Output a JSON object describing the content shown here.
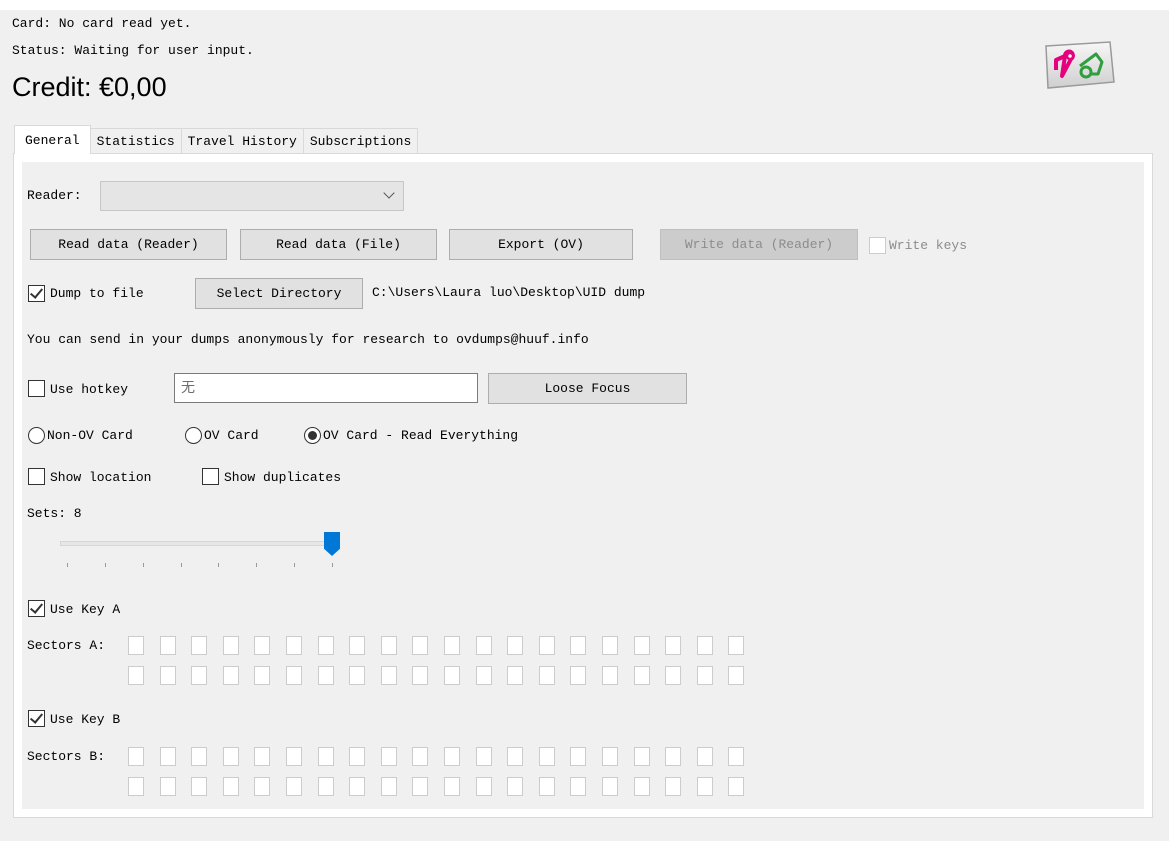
{
  "header": {
    "card_label": "Card: No card read yet.",
    "status_label": "Status: Waiting for user input.",
    "credit_label": "Credit: €0,00",
    "logo_icon": "ov-chipkaart-logo",
    "logo_colors": {
      "pink": "#e6007e",
      "green": "#2e9e3e"
    }
  },
  "tabs": [
    {
      "label": "General",
      "active": true
    },
    {
      "label": "Statistics",
      "active": false
    },
    {
      "label": "Travel History",
      "active": false
    },
    {
      "label": "Subscriptions",
      "active": false
    }
  ],
  "general": {
    "reader_label": "Reader:",
    "reader_value": "",
    "buttons": {
      "read_reader": "Read data (Reader)",
      "read_file": "Read data (File)",
      "export_ov": "Export (OV)",
      "write_reader": "Write data (Reader)",
      "select_directory": "Select Directory",
      "loose_focus": "Loose Focus"
    },
    "write_keys": {
      "label": "Write keys",
      "checked": false,
      "enabled": false
    },
    "dump_to_file": {
      "label": "Dump to file",
      "checked": true
    },
    "dump_path": "C:\\Users\\Laura luo\\Desktop\\UID dump",
    "research_note": "You can send in your dumps anonymously for research to ovdumps@huuf.info",
    "use_hotkey": {
      "label": "Use hotkey",
      "checked": false
    },
    "hotkey_value": "无",
    "card_mode": {
      "options": [
        "Non-OV Card",
        "OV Card",
        "OV Card - Read Everything"
      ],
      "selected": "OV Card - Read Everything"
    },
    "show_location": {
      "label": "Show location",
      "checked": false
    },
    "show_duplicates": {
      "label": "Show duplicates",
      "checked": false
    },
    "sets_label": "Sets: 8",
    "sets_slider": {
      "min": 1,
      "max": 8,
      "value": 8,
      "accent": "#0078d7"
    },
    "use_key_a": {
      "label": "Use Key A",
      "checked": true
    },
    "sectors_a_label": "Sectors A:",
    "use_key_b": {
      "label": "Use Key B",
      "checked": true
    },
    "sectors_b_label": "Sectors B:",
    "sector_count": 40,
    "sectors_per_row": 20
  }
}
